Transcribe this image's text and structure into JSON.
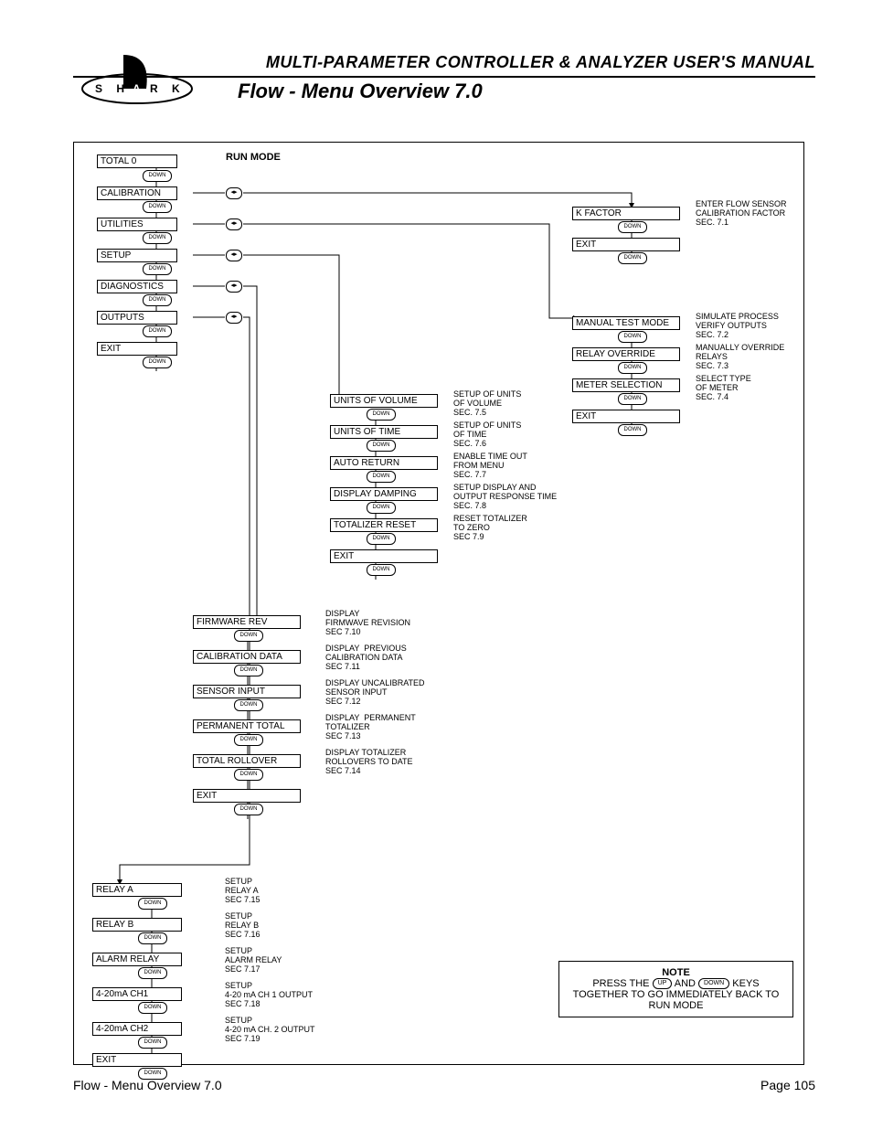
{
  "header": {
    "manual_title": "MULTI-PARAMETER CONTROLLER & ANALYZER USER'S MANUAL",
    "section_title": "Flow - Menu Overview 7.0",
    "logo_letters": "S H A R K"
  },
  "footer": {
    "left": "Flow - Menu Overview 7.0",
    "right": "Page 105"
  },
  "labels": {
    "run_mode": "RUN MODE",
    "down": "DOWN",
    "enter_glyph": "◂▸"
  },
  "main_menu": [
    {
      "label": "TOTAL   0"
    },
    {
      "label": "CALIBRATION"
    },
    {
      "label": "UTILITIES"
    },
    {
      "label": "SETUP"
    },
    {
      "label": "DIAGNOSTICS"
    },
    {
      "label": "OUTPUTS"
    },
    {
      "label": "EXIT"
    }
  ],
  "calibration_sub": [
    {
      "label": "K FACTOR",
      "desc": "ENTER FLOW SENSOR\nCALIBRATION FACTOR\nSEC. 7.1"
    },
    {
      "label": "EXIT"
    }
  ],
  "utilities_sub": [
    {
      "label": "MANUAL TEST MODE",
      "desc": "SIMULATE PROCESS\nVERIFY OUTPUTS\nSEC. 7.2"
    },
    {
      "label": "RELAY OVERRIDE",
      "desc": "MANUALLY OVERRIDE\nRELAYS\nSEC. 7.3"
    },
    {
      "label": "METER SELECTION",
      "desc": "SELECT TYPE\nOF METER\nSEC. 7.4"
    },
    {
      "label": "EXIT"
    }
  ],
  "setup_sub": [
    {
      "label": "UNITS OF VOLUME",
      "desc": "SETUP OF UNITS\nOF VOLUME\nSEC. 7.5"
    },
    {
      "label": "UNITS OF TIME",
      "desc": "SETUP OF UNITS\nOF TIME\nSEC. 7.6"
    },
    {
      "label": "AUTO RETURN",
      "desc": "ENABLE TIME OUT\nFROM MENU\nSEC. 7.7"
    },
    {
      "label": "DISPLAY DAMPING",
      "desc": "SETUP DISPLAY AND\nOUTPUT RESPONSE TIME\nSEC. 7.8"
    },
    {
      "label": "TOTALIZER RESET",
      "desc": "RESET TOTALIZER\nTO ZERO\nSEC 7.9"
    },
    {
      "label": "EXIT"
    }
  ],
  "diagnostics_sub": [
    {
      "label": "FIRMWARE REV",
      "desc": "DISPLAY\nFIRMWAVE REVISION\nSEC 7.10"
    },
    {
      "label": "CALIBRATION DATA",
      "desc": "DISPLAY  PREVIOUS\nCALIBRATION DATA\nSEC 7.11"
    },
    {
      "label": "SENSOR INPUT",
      "desc": "DISPLAY UNCALIBRATED\nSENSOR INPUT\nSEC 7.12"
    },
    {
      "label": "PERMANENT TOTAL",
      "desc": "DISPLAY  PERMANENT\nTOTALIZER\nSEC 7.13"
    },
    {
      "label": "TOTAL ROLLOVER",
      "desc": "DISPLAY TOTALIZER\nROLLOVERS TO DATE\nSEC 7.14"
    },
    {
      "label": "EXIT"
    }
  ],
  "outputs_sub": [
    {
      "label": "RELAY A",
      "desc": "SETUP\nRELAY A\nSEC 7.15"
    },
    {
      "label": "RELAY B",
      "desc": "SETUP\nRELAY B\nSEC 7.16"
    },
    {
      "label": "ALARM RELAY",
      "desc": "SETUP\nALARM RELAY\nSEC 7.17"
    },
    {
      "label": "4-20mA CH1",
      "desc": "SETUP\n4-20 mA CH 1 OUTPUT\nSEC 7.18"
    },
    {
      "label": "4-20mA CH2",
      "desc": "SETUP\n4-20 mA CH. 2 OUTPUT\nSEC 7.19"
    },
    {
      "label": "EXIT"
    }
  ],
  "note": {
    "title": "NOTE",
    "line1_a": "PRESS THE",
    "line1_b": "AND",
    "line1_c": "KEYS",
    "up": "UP",
    "down": "DOWN",
    "line2": "TOGETHER TO GO IMMEDIATELY BACK TO",
    "line3": "RUN MODE"
  }
}
